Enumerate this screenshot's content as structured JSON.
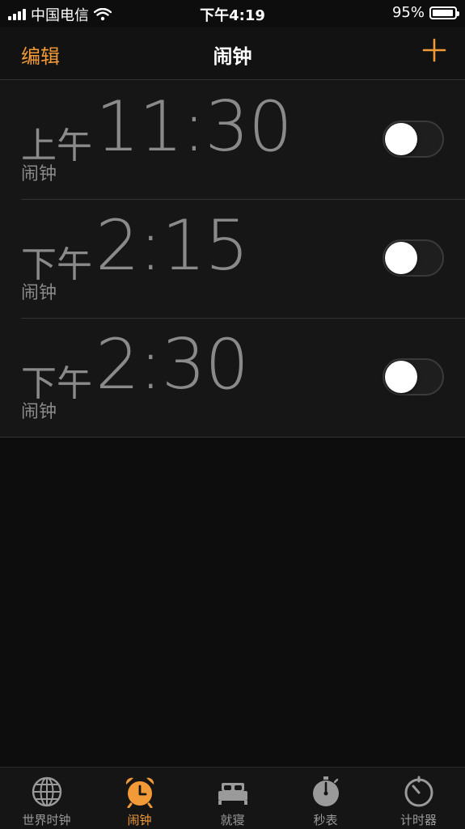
{
  "status_bar": {
    "carrier": "中国电信",
    "time": "下午4:19",
    "battery_percent": "95%",
    "battery_level": 0.95
  },
  "nav": {
    "edit_label": "编辑",
    "title": "闹钟",
    "add_icon": "plus-icon"
  },
  "alarms": [
    {
      "ampm": "上午",
      "time": "11:30",
      "label": "闹钟",
      "enabled": false
    },
    {
      "ampm": "下午",
      "time": "2:15",
      "label": "闹钟",
      "enabled": false
    },
    {
      "ampm": "下午",
      "time": "2:30",
      "label": "闹钟",
      "enabled": false
    }
  ],
  "tabs": [
    {
      "label": "世界时钟",
      "icon": "globe-icon",
      "active": false
    },
    {
      "label": "闹钟",
      "icon": "alarm-clock-icon",
      "active": true
    },
    {
      "label": "就寝",
      "icon": "bed-icon",
      "active": false
    },
    {
      "label": "秒表",
      "icon": "stopwatch-icon",
      "active": false
    },
    {
      "label": "计时器",
      "icon": "timer-icon",
      "active": false
    }
  ],
  "colors": {
    "accent": "#f19a37",
    "text_dim": "#8a8a8a",
    "inactive_tab": "#9a9a9a"
  }
}
